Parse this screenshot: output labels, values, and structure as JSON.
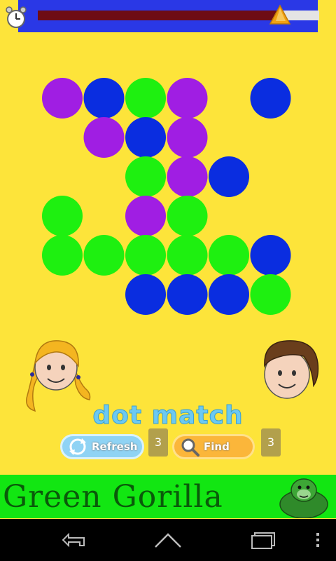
{
  "game": {
    "title": "dot match",
    "timer_progress": 0.86
  },
  "board": {
    "rows": [
      [
        "purple",
        "blue",
        "green",
        "purple",
        "",
        "blue"
      ],
      [
        "",
        "purple",
        "blue",
        "purple",
        "",
        ""
      ],
      [
        "",
        "",
        "green",
        "purple",
        "blue",
        ""
      ],
      [
        "green",
        "",
        "purple",
        "green",
        "",
        ""
      ],
      [
        "green",
        "green",
        "green",
        "green",
        "green",
        "blue"
      ],
      [
        "",
        "",
        "blue",
        "blue",
        "blue",
        "green"
      ]
    ],
    "colors": {
      "purple": "#a01ee3",
      "blue": "#0a2de0",
      "green": "#1ef010"
    }
  },
  "buttons": {
    "refresh_label": "Refresh",
    "refresh_count": "3",
    "find_label": "Find",
    "find_count": "3"
  },
  "ad": {
    "text": "Green Gorilla"
  },
  "icons": {
    "clock": "alarm-clock-icon",
    "refresh": "refresh-icon",
    "find": "magnifier-icon"
  }
}
